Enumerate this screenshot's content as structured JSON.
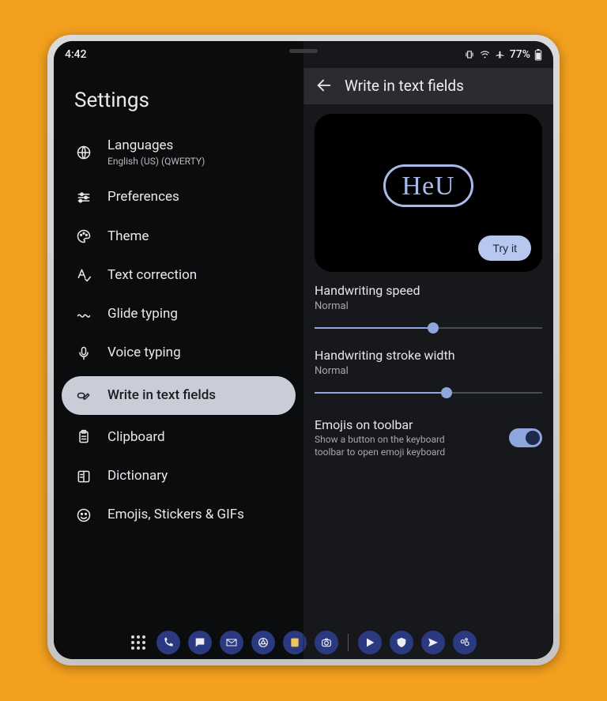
{
  "status": {
    "time": "4:42",
    "battery": "77%"
  },
  "left": {
    "title": "Settings",
    "items": [
      {
        "icon": "globe-icon",
        "label": "Languages",
        "sub": "English (US) (QWERTY)"
      },
      {
        "icon": "sliders-icon",
        "label": "Preferences"
      },
      {
        "icon": "palette-icon",
        "label": "Theme"
      },
      {
        "icon": "spellcheck-icon",
        "label": "Text correction"
      },
      {
        "icon": "squiggle-icon",
        "label": "Glide typing"
      },
      {
        "icon": "mic-icon",
        "label": "Voice typing"
      },
      {
        "icon": "pen-field-icon",
        "label": "Write in text fields",
        "selected": true
      },
      {
        "icon": "clipboard-icon",
        "label": "Clipboard"
      },
      {
        "icon": "dictionary-icon",
        "label": "Dictionary"
      },
      {
        "icon": "emoji-icon",
        "label": "Emojis, Stickers & GIFs"
      }
    ]
  },
  "right": {
    "header_title": "Write in text fields",
    "preview_text": "HeU",
    "try_it": "Try it",
    "speed": {
      "title": "Handwriting speed",
      "value": "Normal",
      "pct": 52
    },
    "stroke": {
      "title": "Handwriting stroke width",
      "value": "Normal",
      "pct": 58
    },
    "emoji_toolbar": {
      "title": "Emojis on toolbar",
      "desc": "Show a button on the keyboard toolbar to open emoji keyboard",
      "on": true
    }
  },
  "taskbar": {
    "icons": [
      "phone",
      "chat",
      "gmail",
      "chrome",
      "notes",
      "camera",
      "play",
      "shield",
      "send",
      "assistant"
    ]
  }
}
